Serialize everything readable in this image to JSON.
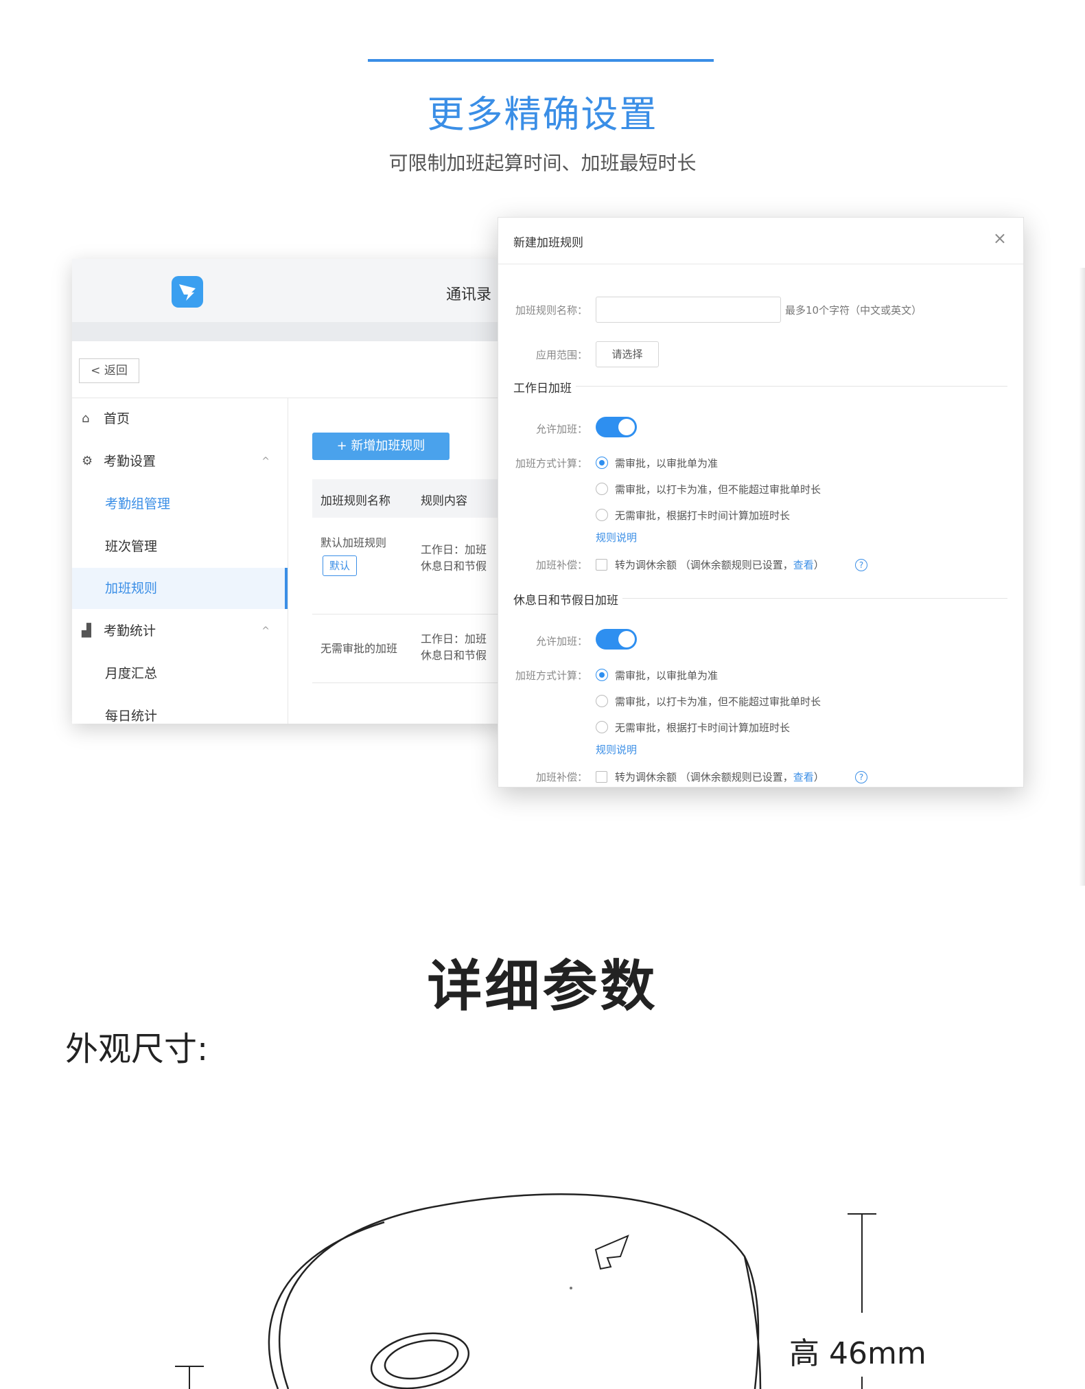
{
  "hero": {
    "title": "更多精确设置",
    "subtitle": "可限制加班起算时间、加班最短时长"
  },
  "admin": {
    "nav_title": "通讯录",
    "back": "< 返回",
    "menu": [
      {
        "icon": "home-icon",
        "label": "首页"
      },
      {
        "icon": "settings-icon",
        "label": "考勤设置",
        "chevron": "^"
      },
      {
        "label": "考勤组管理"
      },
      {
        "label": "班次管理"
      },
      {
        "label": "加班规则"
      },
      {
        "icon": "chart-icon",
        "label": "考勤统计",
        "chevron": "^"
      },
      {
        "label": "月度汇总"
      },
      {
        "label": "每日统计"
      }
    ],
    "add_button": "+  新增加班规则",
    "table": {
      "headers": [
        "加班规则名称",
        "规则内容"
      ],
      "rows": [
        {
          "name": "默认加班规则",
          "tag": "默认",
          "content_1": "工作日：加班",
          "content_2": "休息日和节假"
        },
        {
          "name": "无需审批的加班",
          "content_1": "工作日：加班",
          "content_2": "休息日和节假"
        }
      ]
    }
  },
  "modal": {
    "title": "新建加班规则",
    "close": "×",
    "name_label": "加班规则名称：",
    "name_hint": "最多10个字符（中文或英文）",
    "scope_label": "应用范围：",
    "scope_button": "请选择",
    "workday": {
      "section": "工作日加班",
      "allow_label": "允许加班：",
      "calc_label": "加班方式计算：",
      "options": [
        "需审批，以审批单为准",
        "需审批，以打卡为准，但不能超过审批单时长",
        "无需审批，根据打卡时间计算加班时长"
      ],
      "rule_link": "规则说明",
      "comp_label": "加班补偿：",
      "comp_text": "转为调休余额 （调休余额规则已设置，",
      "comp_link": "查看",
      "comp_end": "）",
      "help": "?"
    },
    "holiday": {
      "section": "休息日和节假日加班",
      "allow_label": "允许加班：",
      "calc_label": "加班方式计算：",
      "options": [
        "需审批，以审批单为准",
        "需审批，以打卡为准，但不能超过审批单时长",
        "无需审批，根据打卡时间计算加班时长"
      ],
      "rule_link": "规则说明",
      "comp_label": "加班补偿：",
      "comp_text": "转为调休余额 （调休余额规则已设置，",
      "comp_link": "查看",
      "comp_end": "）",
      "help": "?"
    }
  },
  "params": {
    "title": "详细参数",
    "dimension_label": "外观尺寸:",
    "height": "高 46mm"
  },
  "colors": {
    "accent": "#3a8ee6",
    "toggle": "#2e8ff0"
  }
}
